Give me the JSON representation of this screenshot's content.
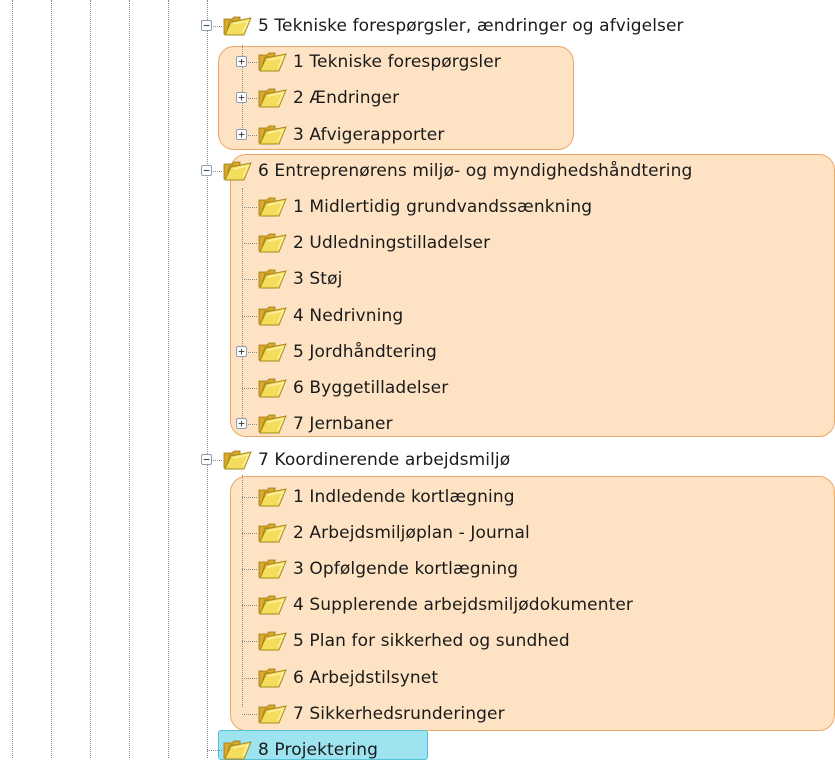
{
  "tree": {
    "colors": {
      "group_highlight_fill": "#fde3c4",
      "group_highlight_border": "#eda866",
      "selected_fill": "#9ee3f0",
      "selected_border": "#55c2d8"
    },
    "node_icon": "open-folder-icon",
    "nodes": [
      {
        "label": "5 Tekniske forespørgsler, ændringer og afvigelser",
        "toggle": "-"
      },
      {
        "label": "1 Tekniske forespørgsler",
        "toggle": "+"
      },
      {
        "label": "2 Ændringer",
        "toggle": "+"
      },
      {
        "label": "3 Afvigerapporter",
        "toggle": "+"
      },
      {
        "label": "6 Entreprenørens miljø- og myndighedshåndtering",
        "toggle": "-"
      },
      {
        "label": "1 Midlertidig grundvandssænkning",
        "toggle": ""
      },
      {
        "label": "2 Udledningstilladelser",
        "toggle": ""
      },
      {
        "label": "3 Støj",
        "toggle": ""
      },
      {
        "label": "4 Nedrivning",
        "toggle": ""
      },
      {
        "label": "5 Jordhåndtering",
        "toggle": "+"
      },
      {
        "label": "6 Byggetilladelser",
        "toggle": ""
      },
      {
        "label": "7 Jernbaner",
        "toggle": "+"
      },
      {
        "label": "7 Koordinerende arbejdsmiljø",
        "toggle": "-"
      },
      {
        "label": "1 Indledende kortlægning",
        "toggle": ""
      },
      {
        "label": "2 Arbejdsmiljøplan - Journal",
        "toggle": ""
      },
      {
        "label": "3 Opfølgende kortlægning",
        "toggle": ""
      },
      {
        "label": "4 Supplerende arbejdsmiljødokumenter",
        "toggle": ""
      },
      {
        "label": "5 Plan for sikkerhed og sundhed",
        "toggle": ""
      },
      {
        "label": "6 Arbejdstilsynet",
        "toggle": ""
      },
      {
        "label": "7 Sikkerhedsrunderinger",
        "toggle": ""
      },
      {
        "label": "8 Projektering",
        "toggle": "",
        "selected": true
      }
    ]
  }
}
